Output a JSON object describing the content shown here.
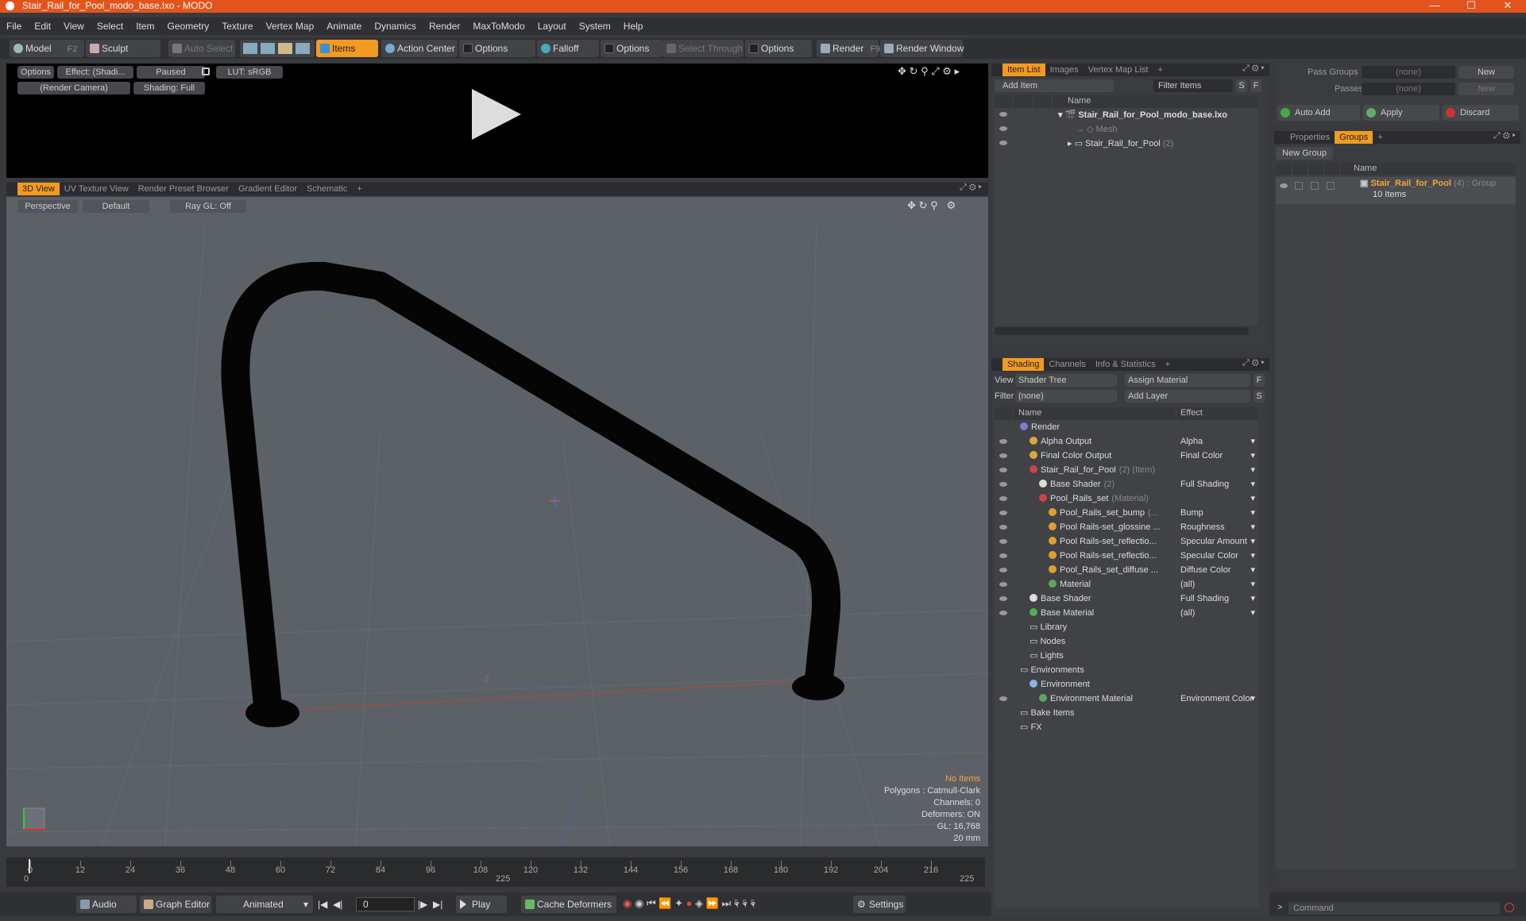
{
  "window": {
    "title": "Stair_Rail_for_Pool_modo_base.lxo - MODO",
    "minimize": "—",
    "maximize": "☐",
    "close": "✕"
  },
  "menu": [
    "File",
    "Edit",
    "View",
    "Select",
    "Item",
    "Geometry",
    "Texture",
    "Vertex Map",
    "Animate",
    "Dynamics",
    "Render",
    "MaxToModo",
    "Layout",
    "System",
    "Help"
  ],
  "toolbar": {
    "model": "Model",
    "model_key": "F2",
    "sculpt": "Sculpt",
    "auto_select": "Auto Select",
    "items": "Items",
    "action_center": "Action Center",
    "options1": "Options",
    "falloff": "Falloff",
    "options2": "Options",
    "select_through": "Select Through",
    "options3": "Options",
    "render": "Render",
    "render_key": "F9",
    "render_window": "Render Window"
  },
  "preview": {
    "options": "Options",
    "effect": "Effect: (Shadi...",
    "paused": "Paused",
    "lut": "LUT: sRGB",
    "camera": "(Render Camera)",
    "shading": "Shading: Full"
  },
  "viewport": {
    "tabs": [
      "3D View",
      "UV Texture View",
      "Render Preset Browser",
      "Gradient Editor",
      "Schematic",
      "+"
    ],
    "perspective": "Perspective",
    "default": "Default",
    "raygl": "Ray GL: Off",
    "axis_label": "-Z",
    "status": {
      "no_items": "No Items",
      "polygons": "Polygons : Catmull-Clark",
      "channels": "Channels: 0",
      "deformers": "Deformers: ON",
      "gl": "GL: 16,768",
      "size": "20 mm"
    }
  },
  "timeline": {
    "labels": [
      "0",
      "12",
      "24",
      "36",
      "48",
      "60",
      "72",
      "84",
      "96",
      "108",
      "120",
      "132",
      "144",
      "156",
      "168",
      "180",
      "192",
      "204",
      "216"
    ],
    "start": "0",
    "mid": "225",
    "end": "225"
  },
  "bottom": {
    "audio": "Audio",
    "graph_editor": "Graph Editor",
    "animated": "Animated",
    "frame": "0",
    "play": "Play",
    "cache_deformers": "Cache Deformers",
    "settings": "Settings"
  },
  "item_list": {
    "tabs": [
      "Item List",
      "Images",
      "Vertex Map List",
      "+"
    ],
    "add_item": "Add Item",
    "filter_items": "Filter Items",
    "s": "S",
    "f": "F",
    "name_header": "Name",
    "rows": [
      {
        "label": "Stair_Rail_for_Pool_modo_base.lxo",
        "extra": ""
      },
      {
        "label": "Mesh",
        "extra": ""
      },
      {
        "label": "Stair_Rail_for_Pool",
        "extra": "(2)"
      }
    ]
  },
  "shading": {
    "tabs": [
      "Shading",
      "Channels",
      "Info & Statistics",
      "+"
    ],
    "view_label": "View",
    "view_value": "Shader Tree",
    "assign_material": "Assign Material",
    "f": "F",
    "filter_label": "Filter",
    "filter_value": "(none)",
    "add_layer": "Add Layer",
    "s": "S",
    "name_header": "Name",
    "effect_header": "Effect",
    "rows": [
      {
        "name": "Render",
        "extra": "",
        "effect": ""
      },
      {
        "name": "Alpha Output",
        "extra": "",
        "effect": "Alpha"
      },
      {
        "name": "Final Color Output",
        "extra": "",
        "effect": "Final Color"
      },
      {
        "name": "Stair_Rail_for_Pool",
        "extra": "(2) (Item)",
        "effect": ""
      },
      {
        "name": "Base Shader",
        "extra": "(2)",
        "effect": "Full Shading"
      },
      {
        "name": "Pool_Rails_set",
        "extra": "(Material)",
        "effect": ""
      },
      {
        "name": "Pool_Rails_set_bump",
        "extra": "(...",
        "effect": "Bump"
      },
      {
        "name": "Pool Rails-set_glossine ...",
        "extra": "",
        "effect": "Roughness"
      },
      {
        "name": "Pool Rails-set_reflectio...",
        "extra": "",
        "effect": "Specular Amount"
      },
      {
        "name": "Pool Rails-set_reflectio...",
        "extra": "",
        "effect": "Specular Color"
      },
      {
        "name": "Pool_Rails_set_diffuse ...",
        "extra": "",
        "effect": "Diffuse Color"
      },
      {
        "name": "Material",
        "extra": "",
        "effect": "(all)"
      },
      {
        "name": "Base Shader",
        "extra": "",
        "effect": "Full Shading"
      },
      {
        "name": "Base Material",
        "extra": "",
        "effect": "(all)"
      },
      {
        "name": "Library",
        "extra": "",
        "effect": ""
      },
      {
        "name": "Nodes",
        "extra": "",
        "effect": ""
      },
      {
        "name": "Lights",
        "extra": "",
        "effect": ""
      },
      {
        "name": "Environments",
        "extra": "",
        "effect": ""
      },
      {
        "name": "Environment",
        "extra": "",
        "effect": ""
      },
      {
        "name": "Environment Material",
        "extra": "",
        "effect": "Environment Color"
      },
      {
        "name": "Bake Items",
        "extra": "",
        "effect": ""
      },
      {
        "name": "FX",
        "extra": "",
        "effect": ""
      }
    ]
  },
  "groups": {
    "pass_groups": "Pass Groups",
    "pass_groups_value": "(none)",
    "new": "New",
    "passes": "Passes",
    "passes_value": "(none)",
    "new2": "New",
    "auto_add": "Auto Add",
    "apply": "Apply",
    "discard": "Discard",
    "tabs": [
      "Properties",
      "Groups",
      "+"
    ],
    "new_group": "New Group",
    "name_header": "Name",
    "group_name": "Stair_Rail_for_Pool",
    "group_extra": "(4) : Group",
    "group_count": "10 Items"
  },
  "command": {
    "placeholder": "Command"
  }
}
